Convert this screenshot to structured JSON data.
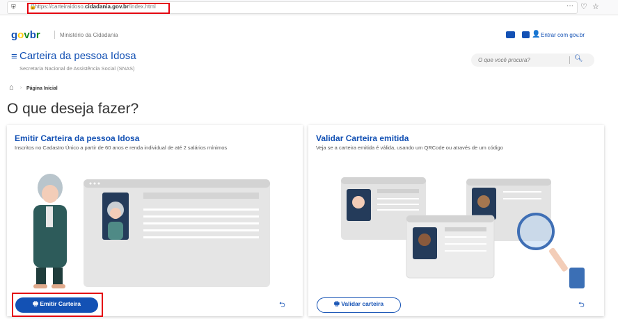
{
  "browser": {
    "url_prefix": "https://carteiraidoso.",
    "url_domain": "cidadania.gov.br",
    "url_suffix": "/index.html",
    "menu_glyph": "···",
    "icons": [
      "shield-icon",
      "lock-icon",
      "pocket-icon",
      "star-icon"
    ]
  },
  "header": {
    "logo_letters": [
      "g",
      "o",
      "v",
      "b",
      "r"
    ],
    "ministry": "Ministério da Cidadania",
    "login_label": "Entrar com gov.br",
    "system_title": "Carteira da pessoa Idosa",
    "system_subtitle": "Secretaria Nacional de Assistência Social (SNAS)",
    "search_placeholder": "O que você procura?"
  },
  "breadcrumb": {
    "current": "Página Inicial"
  },
  "page_title": "O que deseja fazer?",
  "cards": [
    {
      "title": "Emitir Carteira da pessoa Idosa",
      "description": "Inscritos no Cadastro Único a partir de 60 anos e renda individual de até 2 salários mínimos",
      "button_label": "Emitir Carteira"
    },
    {
      "title": "Validar Carteira emitida",
      "description": "Veja se a carteira emitida é válida, usando um QRCode ou através de um código",
      "button_label": "Validar carteira"
    }
  ],
  "colors": {
    "brand_blue": "#1351b4",
    "highlight_red": "#e4000f",
    "logo_green": "#168821",
    "logo_yellow": "#ffcd07"
  }
}
